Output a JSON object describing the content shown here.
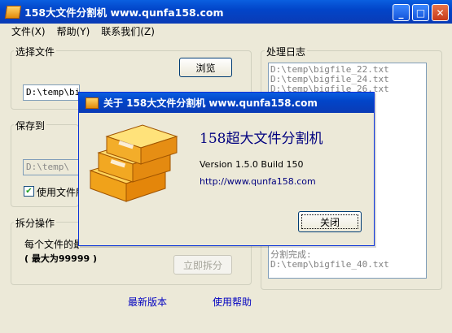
{
  "main_window": {
    "title": "158大文件分割机 www.qunfa158.com",
    "controls": {
      "minimize": "_",
      "maximize": "□",
      "close": "✕"
    }
  },
  "menu": [
    {
      "label": "文件(X)"
    },
    {
      "label": "帮助(Y)"
    },
    {
      "label": "联系我们(Z)"
    }
  ],
  "select_file": {
    "label": "选择文件",
    "browse_label": "浏览",
    "path": "D:\\temp\\bigfil"
  },
  "save_to": {
    "label": "保存到",
    "path": "D:\\temp\\",
    "checkbox_label": "使用文件所",
    "checked": true
  },
  "split": {
    "label": "拆分操作",
    "size_text": "每个文件的最",
    "max_text": "( 最大为99999 )",
    "button_label": "立即拆分"
  },
  "footer": {
    "latest_version": "最新版本",
    "help": "使用帮助"
  },
  "log": {
    "label": "处理日志",
    "lines_top": [
      "D:\\temp\\bigfile_22.txt",
      "D:\\temp\\bigfile_24.txt",
      "D:\\temp\\bigfile_26.txt"
    ],
    "lines_bottom": [
      "分割完成:",
      "D:\\temp\\bigfile_40.txt"
    ]
  },
  "about_dialog": {
    "title": "关于 158大文件分割机 www.qunfa158.com",
    "app_name": "158超大文件分割机",
    "version": "Version 1.5.0 Build 150",
    "url": "http://www.qunfa158.com",
    "close_label": "关闭",
    "accent_color": "#00007f"
  }
}
